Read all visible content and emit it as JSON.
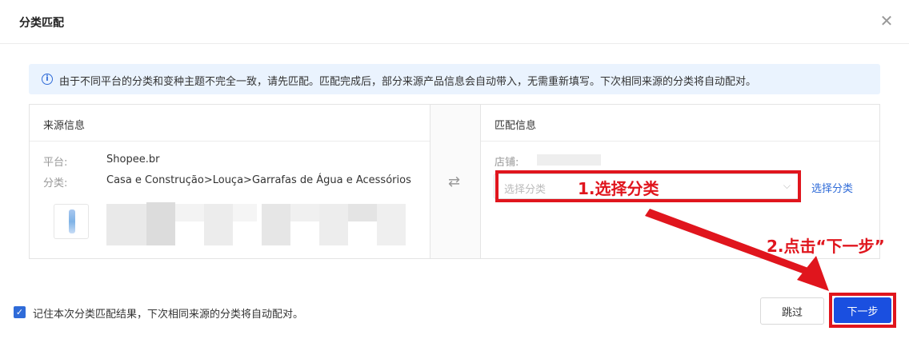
{
  "dialog": {
    "title": "分类匹配",
    "close_symbol": "✕",
    "notice": {
      "icon": "info-icon",
      "icon_glyph": "i",
      "text": "由于不同平台的分类和变种主题不完全一致，请先匹配。匹配完成后，部分来源产品信息会自动带入，无需重新填写。下次相同来源的分类将自动配对。"
    },
    "source": {
      "heading": "来源信息",
      "platform_label": "平台:",
      "platform_value": "Shopee.br",
      "category_label": "分类:",
      "category_value": "Casa e Construção>Louça>Garrafas de Água e Acessórios"
    },
    "swap_symbol": "⇄",
    "match": {
      "heading": "匹配信息",
      "shop_label": "店铺:",
      "select_placeholder": "选择分类",
      "select_arrow": "⌵",
      "select_link": "选择分类"
    },
    "annotations": {
      "step1": "1.选择分类",
      "step2": "2.点击“下一步”",
      "color": "#e0151d"
    },
    "footer": {
      "checkbox_checked": true,
      "checkbox_glyph": "✓",
      "remember_text": "记住本次分类匹配结果，下次相同来源的分类将自动配对。",
      "skip_label": "跳过",
      "next_label": "下一步"
    },
    "colors": {
      "primary": "#1a4fe0",
      "link": "#2f6bd8",
      "notice_bg": "#eaf3fe"
    }
  }
}
